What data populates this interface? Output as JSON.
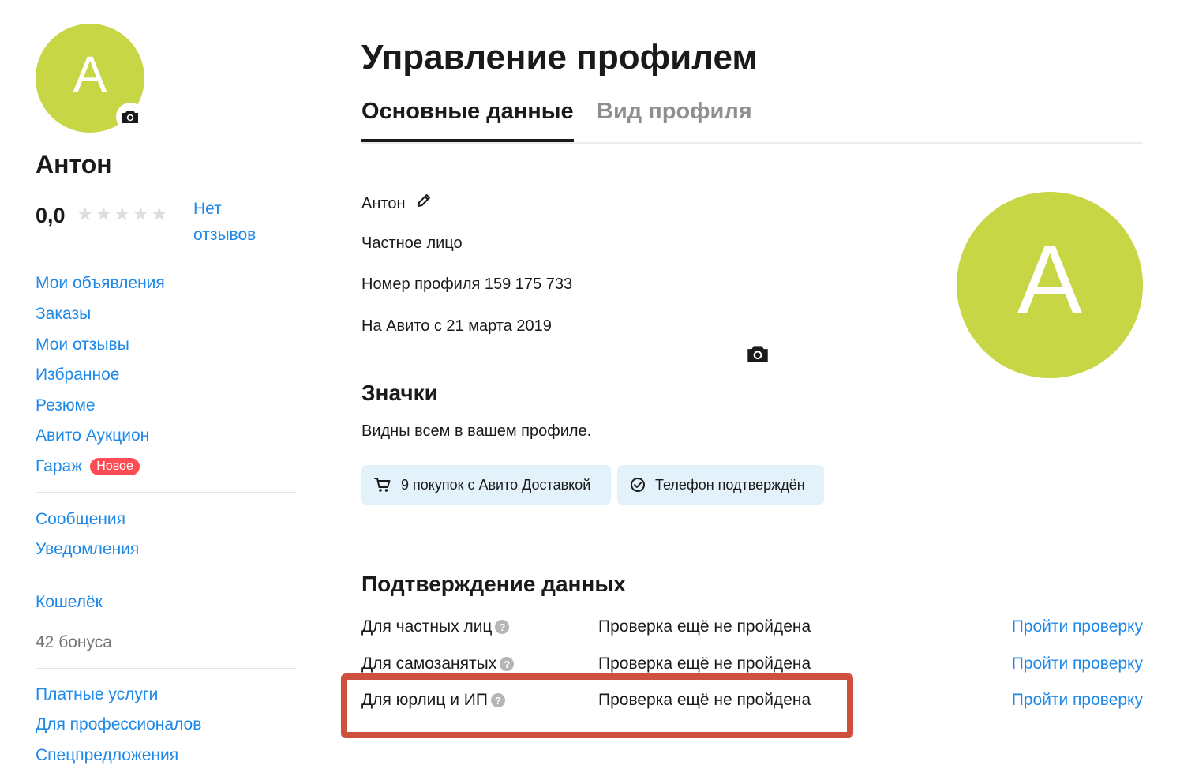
{
  "sidebar": {
    "avatar_letter": "А",
    "user_name": "Антон",
    "rating": "0,0",
    "no_reviews": "Нет отзывов",
    "group1": [
      "Мои объявления",
      "Заказы",
      "Мои отзывы",
      "Избранное",
      "Резюме",
      "Авито Аукцион"
    ],
    "garage": {
      "label": "Гараж",
      "badge": "Новое"
    },
    "group2": [
      "Сообщения",
      "Уведомления"
    ],
    "wallet": "Кошелёк",
    "bonus": "42 бонуса",
    "group3": [
      "Платные услуги",
      "Для профессионалов",
      "Спецпредложения"
    ]
  },
  "main": {
    "title": "Управление профилем",
    "tabs": [
      "Основные данные",
      "Вид профиля"
    ],
    "name": "Антон",
    "account_type": "Частное лицо",
    "profile_number": "Номер профиля 159 175 733",
    "since": "На Авито с 21 марта 2019",
    "avatar_letter": "А",
    "badges": {
      "title": "Значки",
      "subtitle": "Видны всем в вашем профиле.",
      "items": [
        "9 покупок с Авито Доставкой",
        "Телефон подтверждён"
      ]
    },
    "verification": {
      "title": "Подтверждение данных",
      "rows": [
        {
          "label": "Для частных лиц",
          "status": "Проверка ещё не пройдена",
          "action": "Пройти проверку"
        },
        {
          "label": "Для самозанятых",
          "status": "Проверка ещё не пройдена",
          "action": "Пройти проверку"
        },
        {
          "label": "Для юрлиц и ИП",
          "status": "Проверка ещё не пройдена",
          "action": "Пройти проверку"
        }
      ]
    }
  },
  "colors": {
    "accent": "#1d88e8",
    "avatar": "#c7d644",
    "badge_new": "#ff4b53",
    "chip_bg": "#e3f1fa",
    "highlight": "#d0503f"
  },
  "icons": [
    "camera-icon",
    "star-icon",
    "pencil-icon",
    "cart-icon",
    "check-circle-icon",
    "question-icon"
  ]
}
